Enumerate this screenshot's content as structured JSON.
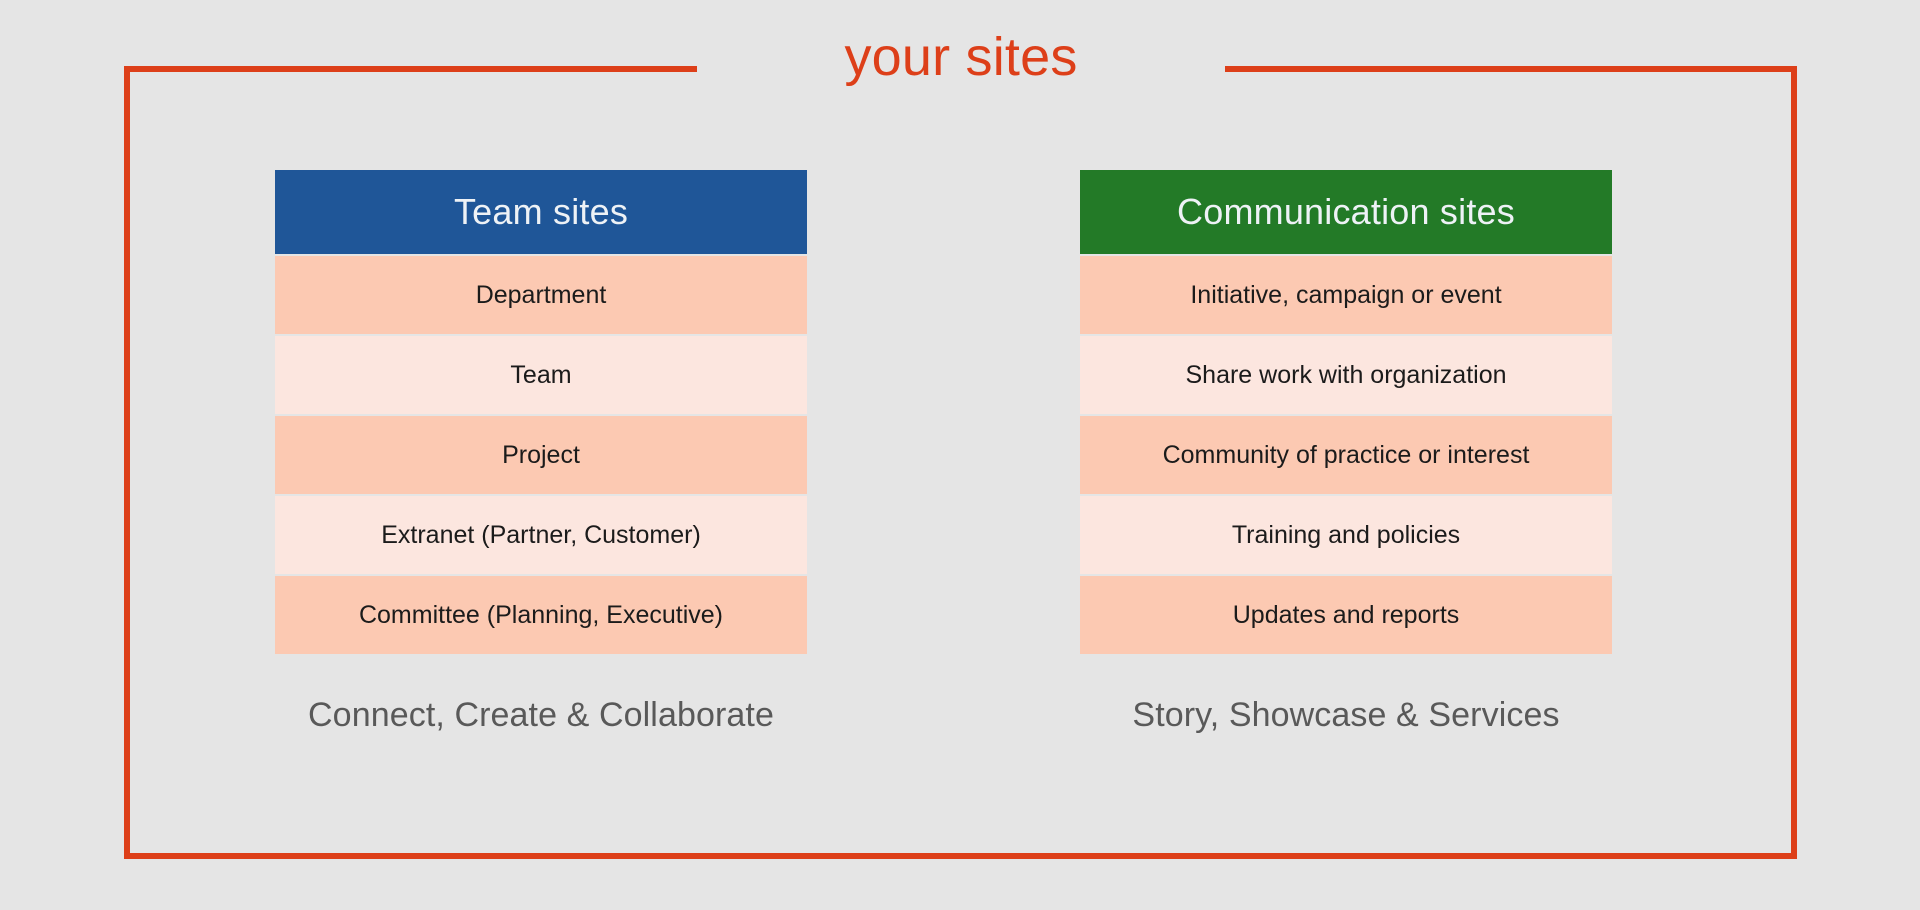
{
  "title": "your sites",
  "colors": {
    "frame": "#dd3f19",
    "title": "#dd3f19",
    "team_header": "#1f5698",
    "communication_header": "#237a27",
    "row_dark": "#fcc9b2",
    "row_light": "#fce6df",
    "background": "#e5e5e5",
    "caption": "#595959"
  },
  "columns": [
    {
      "header": "Team sites",
      "header_style": "blue",
      "rows": [
        "Department",
        "Team",
        "Project",
        "Extranet (Partner, Customer)",
        "Committee (Planning, Executive)"
      ],
      "caption": "Connect, Create & Collaborate"
    },
    {
      "header": "Communication sites",
      "header_style": "green",
      "rows": [
        "Initiative, campaign or event",
        "Share work with organization",
        "Community of practice or interest",
        "Training and policies",
        "Updates and reports"
      ],
      "caption": "Story, Showcase & Services"
    }
  ]
}
